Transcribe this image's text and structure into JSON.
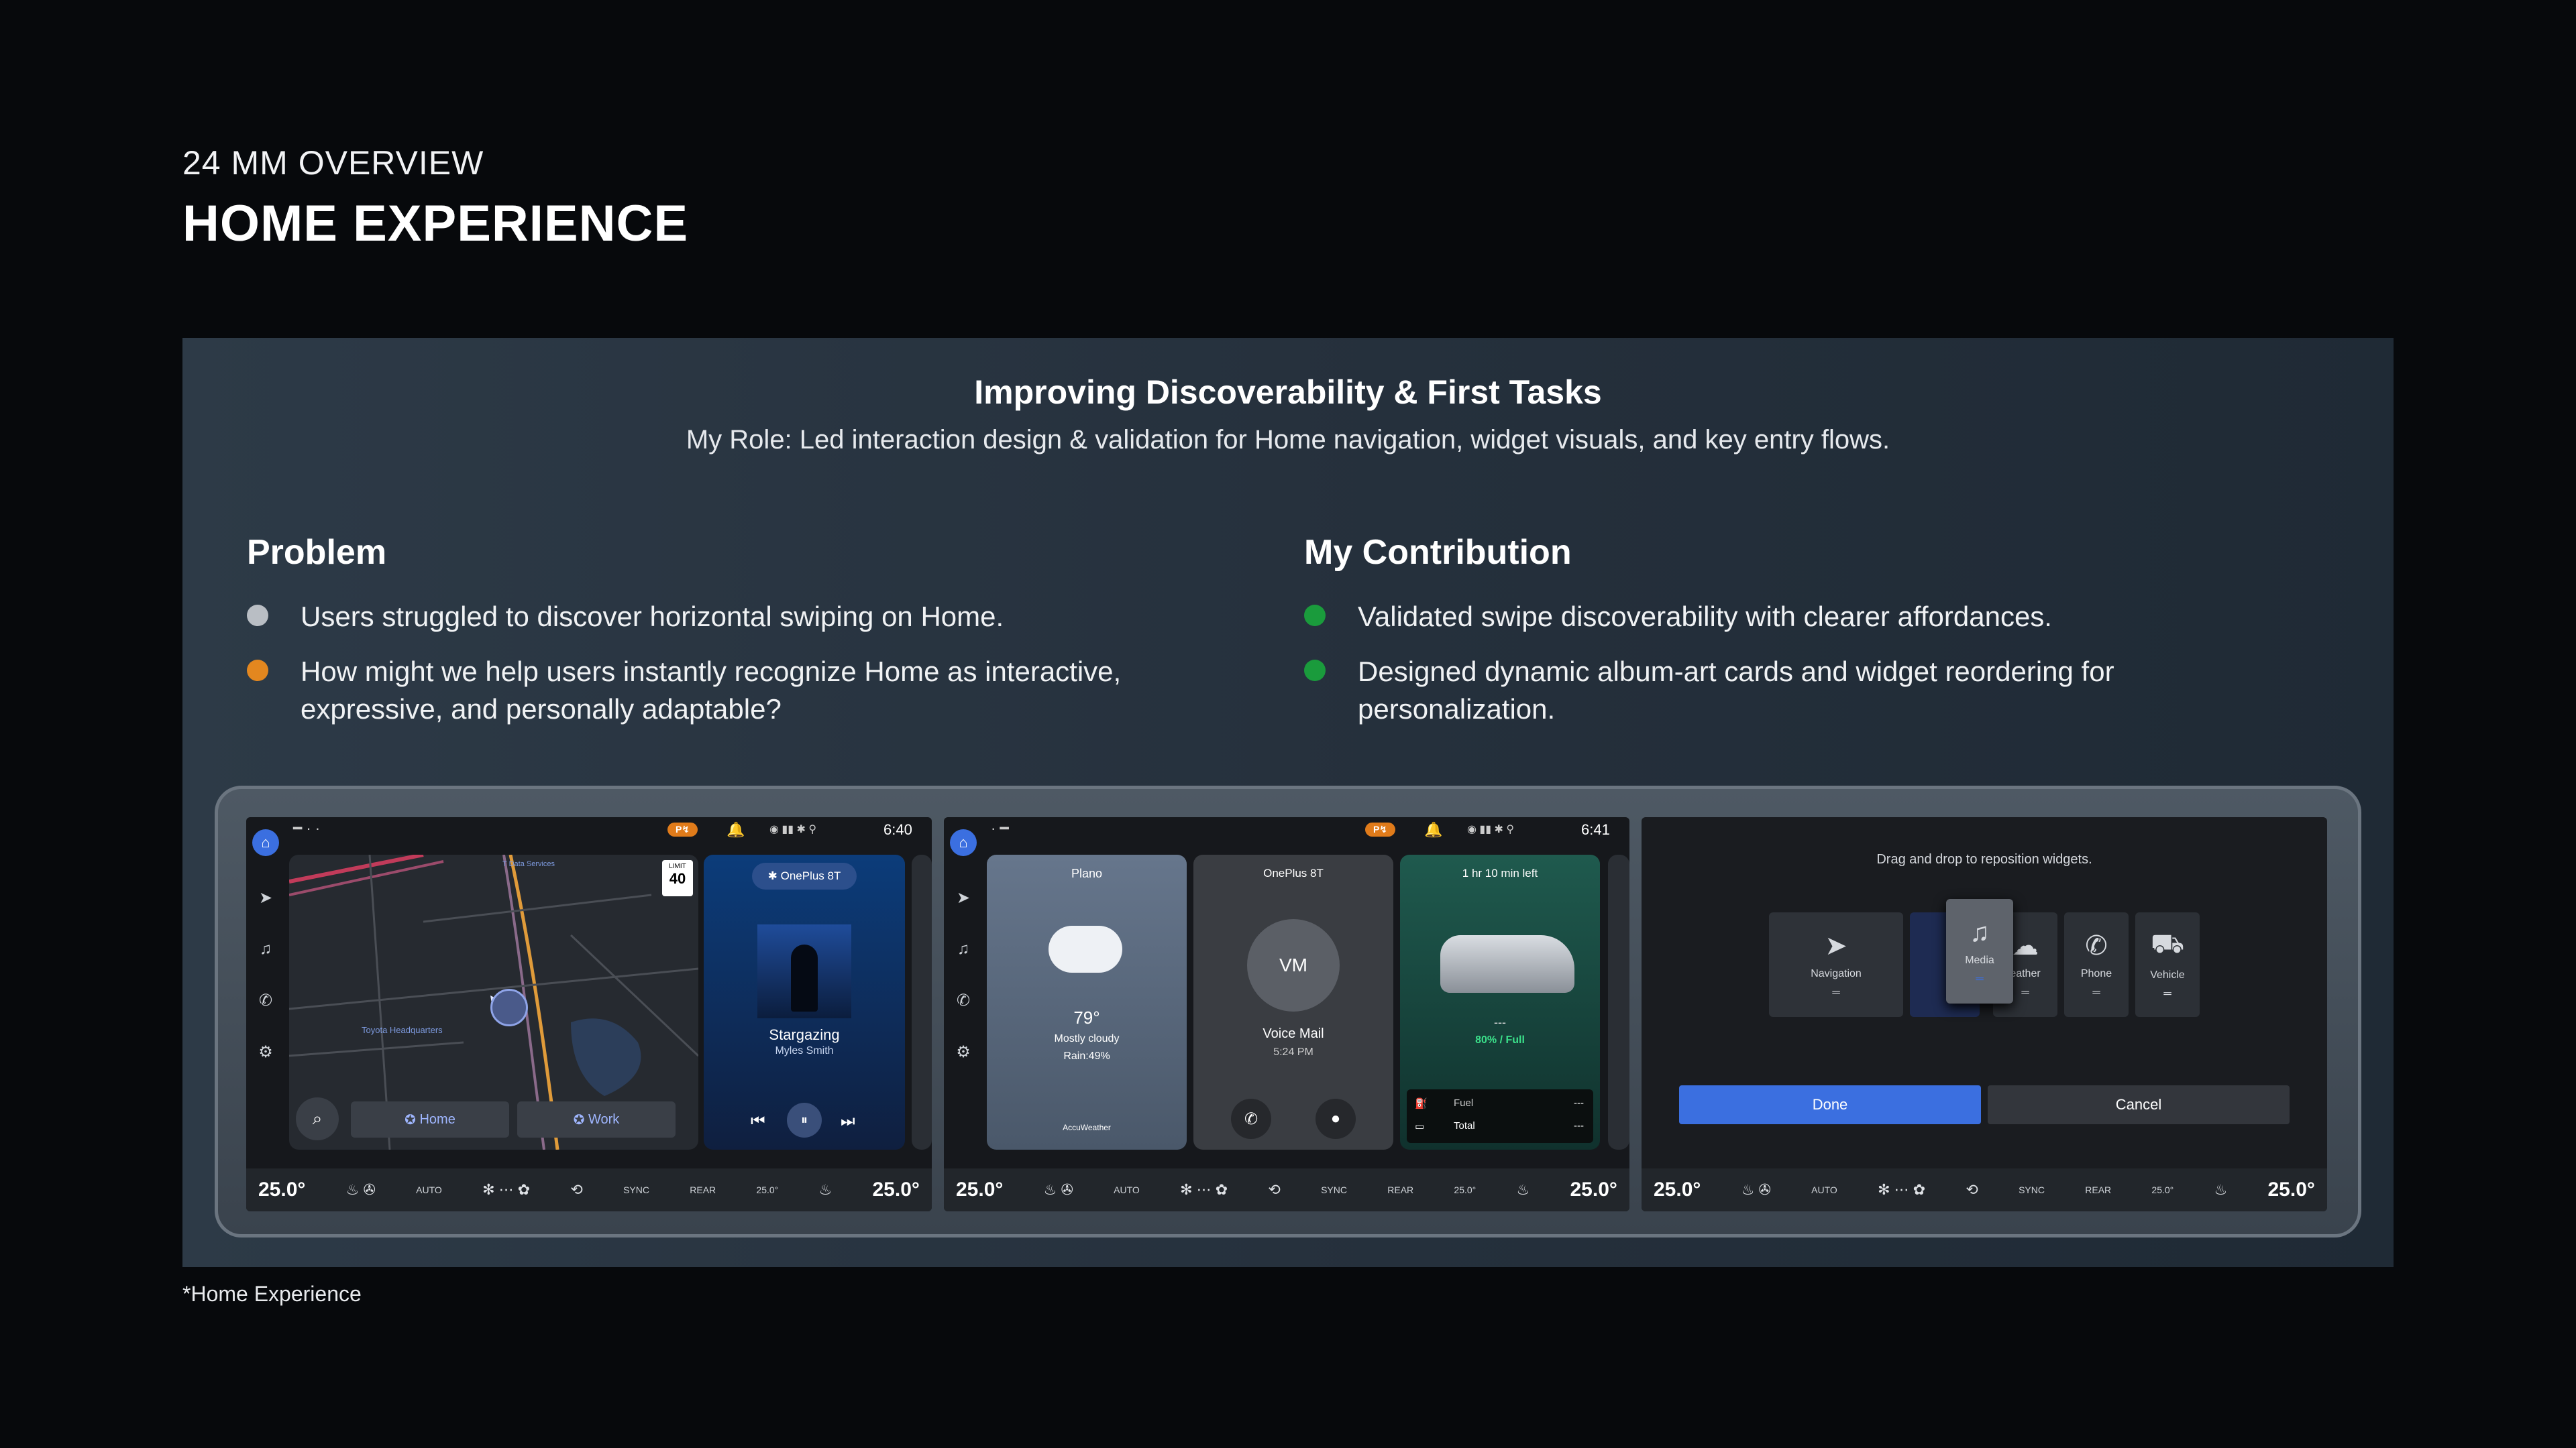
{
  "header": {
    "eyebrow": "24 MM OVERVIEW",
    "title": "HOME EXPERIENCE"
  },
  "panel": {
    "title": "Improving Discoverability & First Tasks",
    "role": "My Role: Led interaction design & validation for Home navigation, widget visuals, and key entry flows.",
    "problem": {
      "heading": "Problem",
      "items": [
        {
          "text": "Users struggled to discover horizontal swiping on Home.",
          "color": "#b9bec4"
        },
        {
          "text": "How might we help users instantly recognize Home as interactive, expressive, and personally adaptable?",
          "color": "#e3871f"
        }
      ]
    },
    "contribution": {
      "heading": "My Contribution",
      "items": [
        {
          "text": "Validated swipe discoverability with clearer affordances.",
          "color": "#1a9b3c"
        },
        {
          "text": "Designed dynamic album-art cards and widget reordering for personalization.",
          "color": "#1a9b3c"
        }
      ]
    }
  },
  "screen1": {
    "time": "6:40",
    "map_label": "Toyota Headquarters",
    "map_label2": "T Data Services",
    "limit_label": "LIMIT",
    "limit": "40",
    "home": "Home",
    "work": "Work",
    "bt": "OnePlus 8T",
    "song": "Stargazing",
    "artist": "Myles Smith"
  },
  "screen2": {
    "time": "6:41",
    "city": "Plano",
    "temp": "79°",
    "cond": "Mostly cloudy",
    "rain": "Rain:49%",
    "provider": "AccuWeather",
    "bt": "OnePlus 8T",
    "vm_initials": "VM",
    "vm": "Voice Mail",
    "vm_time": "5:24 PM",
    "time_left": "1 hr 10 min left",
    "range": "---",
    "battery": "80% / Full",
    "fuel_label": "Fuel",
    "total_label": "Total",
    "fuel_val": "---",
    "total_val": "---"
  },
  "screen3": {
    "hint": "Drag and drop to reposition widgets.",
    "w_nav": "Navigation",
    "w_media": "Media",
    "w_weather": "eather",
    "w_phone": "Phone",
    "w_vehicle": "Vehicle",
    "done": "Done",
    "cancel": "Cancel"
  },
  "climate": {
    "left": "25.0°",
    "right": "25.0°",
    "auto": "AUTO",
    "sync": "SYNC",
    "rear": "REAR",
    "rear_temp": "25.0°"
  },
  "footnote": "*Home Experience",
  "colors": {
    "accent": "#3b6fe0",
    "orange": "#e3871f",
    "green": "#1a9b3c"
  }
}
